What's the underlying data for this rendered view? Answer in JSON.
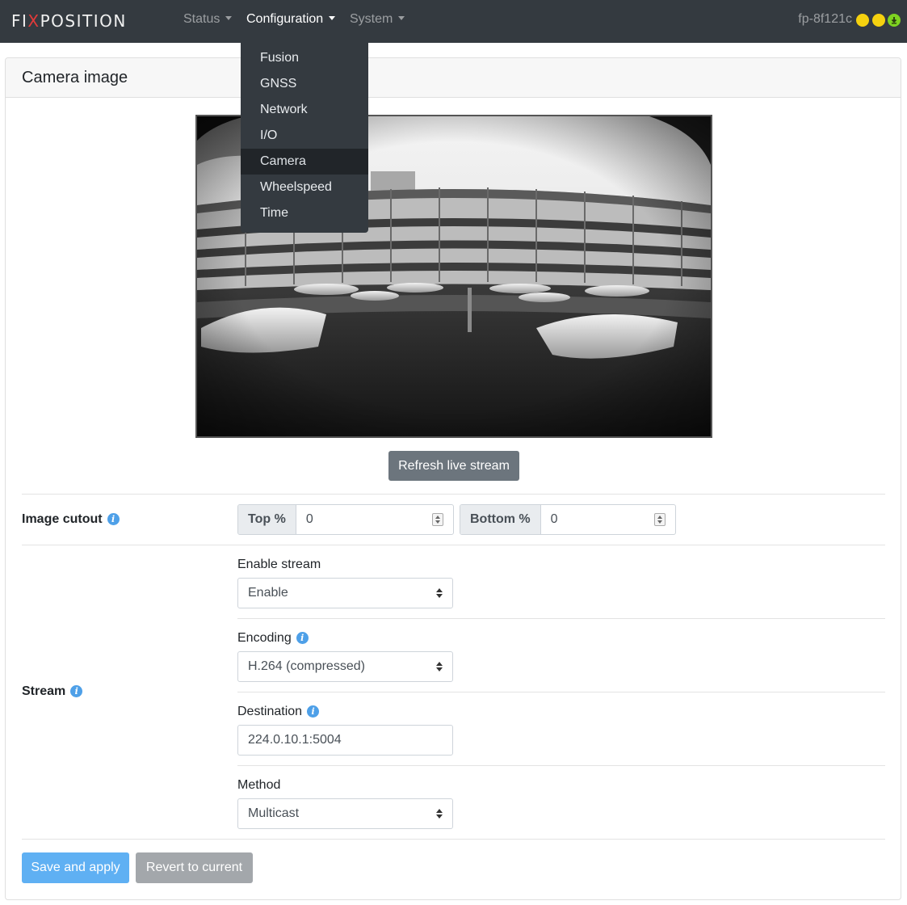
{
  "brand": {
    "prefix": "FI",
    "x": "X",
    "suffix": "POSITION"
  },
  "nav": {
    "status": "Status",
    "configuration": "Configuration",
    "system": "System",
    "device": "fp-8f121c"
  },
  "dropdown": {
    "items": [
      "Fusion",
      "GNSS",
      "Network",
      "I/O",
      "Camera",
      "Wheelspeed",
      "Time"
    ],
    "active": "Camera"
  },
  "card": {
    "title": "Camera image"
  },
  "refresh_button": "Refresh live stream",
  "image_cutout": {
    "label": "Image cutout",
    "top_label": "Top %",
    "top_value": "0",
    "bottom_label": "Bottom %",
    "bottom_value": "0"
  },
  "stream": {
    "label": "Stream",
    "enable_label": "Enable stream",
    "enable_value": "Enable",
    "encoding_label": "Encoding",
    "encoding_value": "H.264 (compressed)",
    "destination_label": "Destination",
    "destination_value": "224.0.10.1:5004",
    "method_label": "Method",
    "method_value": "Multicast"
  },
  "buttons": {
    "save": "Save and apply",
    "revert": "Revert to current"
  },
  "colors": {
    "navbar": "#343a40",
    "status_yellow": "#f5d10f",
    "status_green": "#7ed321",
    "primary": "#5fb0f3",
    "info": "#4ea0e8"
  }
}
